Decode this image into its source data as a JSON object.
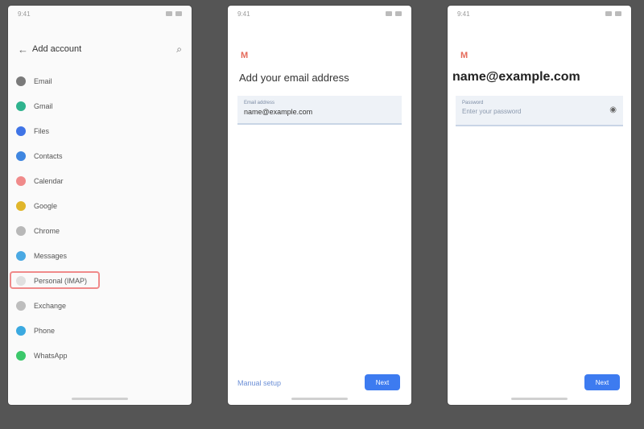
{
  "screens": [
    {
      "status": {
        "time": "9:41",
        "right": "▲ ▲"
      },
      "header": {
        "title": "Add account"
      },
      "menu": [
        {
          "label": "Email",
          "color": "#7a7a7a"
        },
        {
          "label": "Gmail",
          "color": "#2fb38e"
        },
        {
          "label": "Files",
          "color": "#3f74e6"
        },
        {
          "label": "Contacts",
          "color": "#3f86e0"
        },
        {
          "label": "Calendar",
          "color": "#f08a8a"
        },
        {
          "label": "Google",
          "color": "#e0b62b"
        },
        {
          "label": "Chrome",
          "color": "#b8b8b8"
        },
        {
          "label": "Messages",
          "color": "#4aa9e3"
        },
        {
          "label": "Personal (IMAP)",
          "color": "#e0e0e0"
        },
        {
          "label": "Exchange",
          "color": "#bdbdbd"
        },
        {
          "label": "Phone",
          "color": "#3ba9e0"
        },
        {
          "label": "WhatsApp",
          "color": "#3cc86b"
        }
      ],
      "highlighted_index": 8
    },
    {
      "status": {
        "time": "9:41",
        "right": "▲ ▲"
      },
      "brand": "M",
      "heading": "Add your email address",
      "field": {
        "label": "Email address",
        "value": "name@example.com"
      },
      "secondary": "Manual setup",
      "primary": "Next"
    },
    {
      "status": {
        "time": "9:41",
        "right": "▲ ▲"
      },
      "brand": "M",
      "heading": "name@example.com",
      "field": {
        "label": "Password",
        "value": "Enter your password"
      },
      "primary": "Next"
    }
  ]
}
